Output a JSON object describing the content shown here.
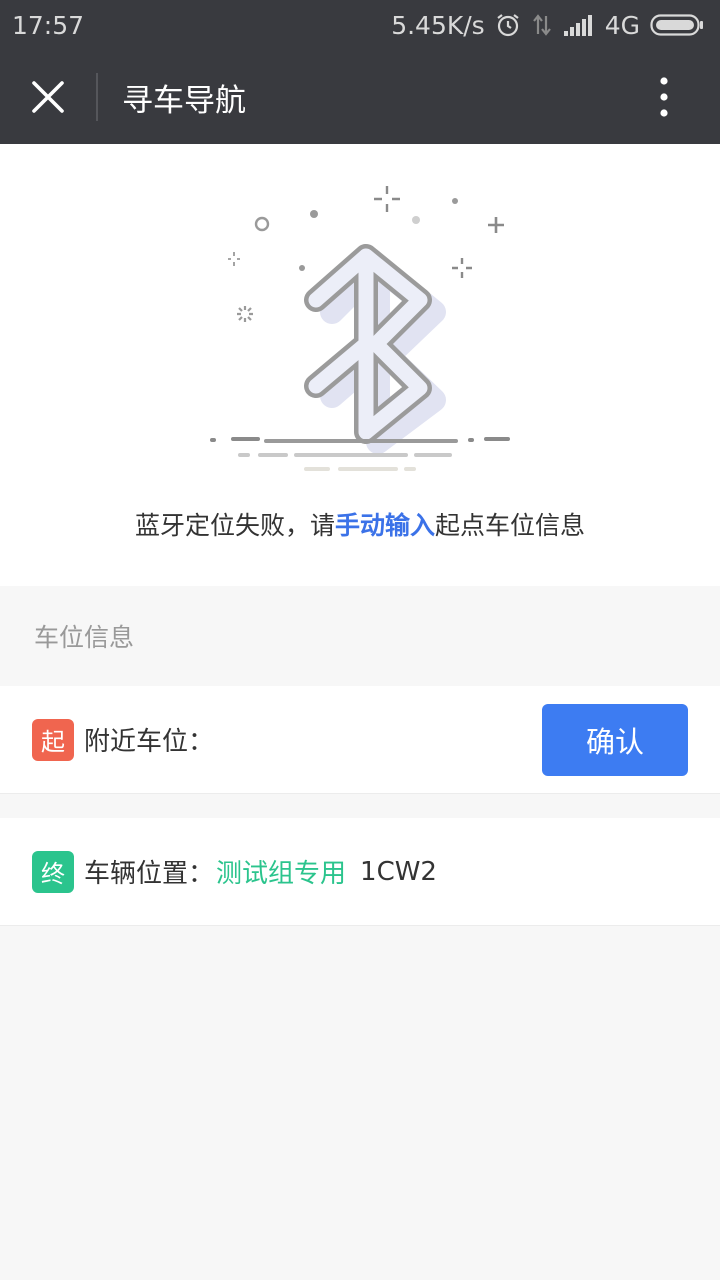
{
  "status_bar": {
    "time": "17:57",
    "network_speed": "5.45K/s",
    "network_type": "4G",
    "icons": [
      "alarm-icon",
      "data-arrows-icon",
      "signal-icon",
      "battery-icon"
    ]
  },
  "nav": {
    "title": "寻车导航",
    "close_icon": "close-icon",
    "more_icon": "more-vertical-icon"
  },
  "hero": {
    "illustration_icon": "bluetooth-icon",
    "message_prefix": "蓝牙定位失败，请",
    "message_link": "手动输入",
    "message_suffix": "起点车位信息"
  },
  "section": {
    "title": "车位信息"
  },
  "start_row": {
    "badge": "起",
    "label": "附近车位：",
    "confirm_label": "确认"
  },
  "end_row": {
    "badge": "终",
    "label": "车辆位置：",
    "lot_group": "测试组专用",
    "lot_number": "1CW2"
  },
  "colors": {
    "nav_bg": "#393a3f",
    "accent_blue": "#3d7cf2",
    "link_blue": "#3b72e8",
    "start_red": "#f0654f",
    "end_green": "#2bc48d"
  }
}
